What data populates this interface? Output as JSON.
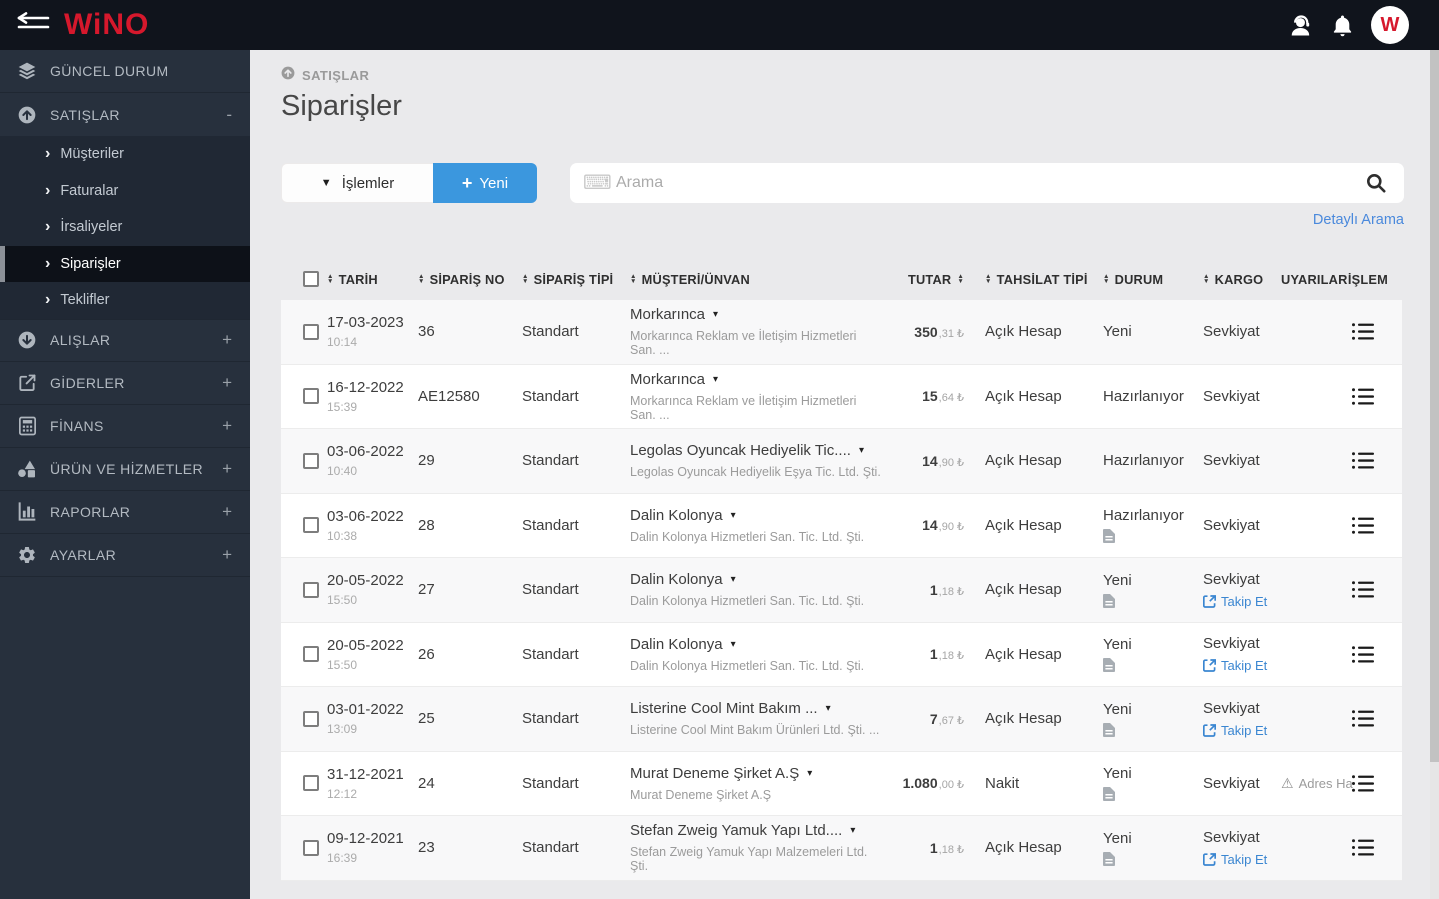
{
  "topbar": {
    "logo": "WiNO",
    "avatar_initial": "W"
  },
  "sidebar": {
    "items": [
      {
        "label": "GÜNCEL DURUM",
        "icon": "layers-icon",
        "suffix": ""
      },
      {
        "label": "SATIŞLAR",
        "icon": "arrow-circle-up-icon",
        "suffix": "-"
      },
      {
        "label": "ALIŞLAR",
        "icon": "arrow-circle-down-icon",
        "suffix": "+"
      },
      {
        "label": "GİDERLER",
        "icon": "share-square-icon",
        "suffix": "+"
      },
      {
        "label": "FİNANS",
        "icon": "calculator-icon",
        "suffix": "+"
      },
      {
        "label": "ÜRÜN VE HİZMETLER",
        "icon": "shapes-icon",
        "suffix": "+"
      },
      {
        "label": "RAPORLAR",
        "icon": "bar-chart-icon",
        "suffix": "+"
      },
      {
        "label": "AYARLAR",
        "icon": "gear-icon",
        "suffix": "+"
      }
    ],
    "satislar_children": [
      {
        "label": "Müşteriler",
        "active": false
      },
      {
        "label": "Faturalar",
        "active": false
      },
      {
        "label": "İrsaliyeler",
        "active": false
      },
      {
        "label": "Siparişler",
        "active": true
      },
      {
        "label": "Teklifler",
        "active": false
      }
    ]
  },
  "main": {
    "breadcrumb": "SATIŞLAR",
    "title": "Siparişler",
    "toolbar": {
      "islemler_label": "İşlemler",
      "yeni_plus": "+",
      "yeni_label": "Yeni",
      "search_placeholder": "Arama",
      "search_value": "",
      "detayli_arama_label": "Detaylı Arama"
    },
    "table": {
      "columns": [
        {
          "label": "TARİH",
          "sort": "before"
        },
        {
          "label": "SİPARİŞ NO",
          "sort": "before"
        },
        {
          "label": "SİPARİŞ TİPİ",
          "sort": "before"
        },
        {
          "label": "MÜŞTERİ/ÜNVAN",
          "sort": "before"
        },
        {
          "label": "TUTAR",
          "sort": "after"
        },
        {
          "label": "TAHSİLAT TİPİ",
          "sort": "before"
        },
        {
          "label": "DURUM",
          "sort": "before"
        },
        {
          "label": "KARGO",
          "sort": "before"
        },
        {
          "label": "UYARILAR",
          "sort": "none"
        },
        {
          "label": "İŞLEM",
          "sort": "none"
        }
      ],
      "currency": "₺",
      "track_label": "Takip Et",
      "rows": [
        {
          "date": "17-03-2023",
          "time": "10:14",
          "no": "36",
          "type": "Standart",
          "customer": "Morkarınca",
          "customer_full": "Morkarınca Reklam ve İletişim Hizmetleri San. ...",
          "amount_int": "350",
          "amount_frac": ",31",
          "payment": "Açık Hesap",
          "status": "Yeni",
          "status_doc": false,
          "cargo": "Sevkiyat",
          "track": false,
          "warning": ""
        },
        {
          "date": "16-12-2022",
          "time": "15:39",
          "no": "AE12580",
          "type": "Standart",
          "customer": "Morkarınca",
          "customer_full": "Morkarınca Reklam ve İletişim Hizmetleri San. ...",
          "amount_int": "15",
          "amount_frac": ",64",
          "payment": "Açık Hesap",
          "status": "Hazırlanıyor",
          "status_doc": false,
          "cargo": "Sevkiyat",
          "track": false,
          "warning": ""
        },
        {
          "date": "03-06-2022",
          "time": "10:40",
          "no": "29",
          "type": "Standart",
          "customer": "Legolas Oyuncak Hediyelik Tic....",
          "customer_full": "Legolas Oyuncak Hediyelik Eşya Tic. Ltd. Şti.",
          "amount_int": "14",
          "amount_frac": ",90",
          "payment": "Açık Hesap",
          "status": "Hazırlanıyor",
          "status_doc": false,
          "cargo": "Sevkiyat",
          "track": false,
          "warning": ""
        },
        {
          "date": "03-06-2022",
          "time": "10:38",
          "no": "28",
          "type": "Standart",
          "customer": "Dalin Kolonya",
          "customer_full": "Dalin Kolonya Hizmetleri San. Tic. Ltd. Şti.",
          "amount_int": "14",
          "amount_frac": ",90",
          "payment": "Açık Hesap",
          "status": "Hazırlanıyor",
          "status_doc": true,
          "cargo": "Sevkiyat",
          "track": false,
          "warning": ""
        },
        {
          "date": "20-05-2022",
          "time": "15:50",
          "no": "27",
          "type": "Standart",
          "customer": "Dalin Kolonya",
          "customer_full": "Dalin Kolonya Hizmetleri San. Tic. Ltd. Şti.",
          "amount_int": "1",
          "amount_frac": ",18",
          "payment": "Açık Hesap",
          "status": "Yeni",
          "status_doc": true,
          "cargo": "Sevkiyat",
          "track": true,
          "warning": ""
        },
        {
          "date": "20-05-2022",
          "time": "15:50",
          "no": "26",
          "type": "Standart",
          "customer": "Dalin Kolonya",
          "customer_full": "Dalin Kolonya Hizmetleri San. Tic. Ltd. Şti.",
          "amount_int": "1",
          "amount_frac": ",18",
          "payment": "Açık Hesap",
          "status": "Yeni",
          "status_doc": true,
          "cargo": "Sevkiyat",
          "track": true,
          "warning": ""
        },
        {
          "date": "03-01-2022",
          "time": "13:09",
          "no": "25",
          "type": "Standart",
          "customer": "Listerine Cool Mint Bakım ...",
          "customer_full": "Listerine Cool Mint Bakım Ürünleri Ltd. Şti. ...",
          "amount_int": "7",
          "amount_frac": ",67",
          "payment": "Açık Hesap",
          "status": "Yeni",
          "status_doc": true,
          "cargo": "Sevkiyat",
          "track": true,
          "warning": ""
        },
        {
          "date": "31-12-2021",
          "time": "12:12",
          "no": "24",
          "type": "Standart",
          "customer": "Murat Deneme Şirket A.Ş",
          "customer_full": "Murat Deneme Şirket A.Ş",
          "amount_int": "1.080",
          "amount_frac": ",00",
          "payment": "Nakit",
          "status": "Yeni",
          "status_doc": true,
          "cargo": "Sevkiyat",
          "track": false,
          "warning": "Adres Ha"
        },
        {
          "date": "09-12-2021",
          "time": "16:39",
          "no": "23",
          "type": "Standart",
          "customer": "Stefan Zweig Yamuk Yapı Ltd....",
          "customer_full": "Stefan Zweig Yamuk Yapı Malzemeleri Ltd. Şti.",
          "amount_int": "1",
          "amount_frac": ",18",
          "payment": "Açık Hesap",
          "status": "Yeni",
          "status_doc": true,
          "cargo": "Sevkiyat",
          "track": true,
          "warning": ""
        }
      ]
    }
  },
  "colors": {
    "topbar": "#10141c",
    "sidebar": "#27303d",
    "accent_blue": "#3b97de",
    "link_blue": "#4a89dc",
    "logo_red": "#d6182c",
    "page_bg": "#eaeaec"
  }
}
